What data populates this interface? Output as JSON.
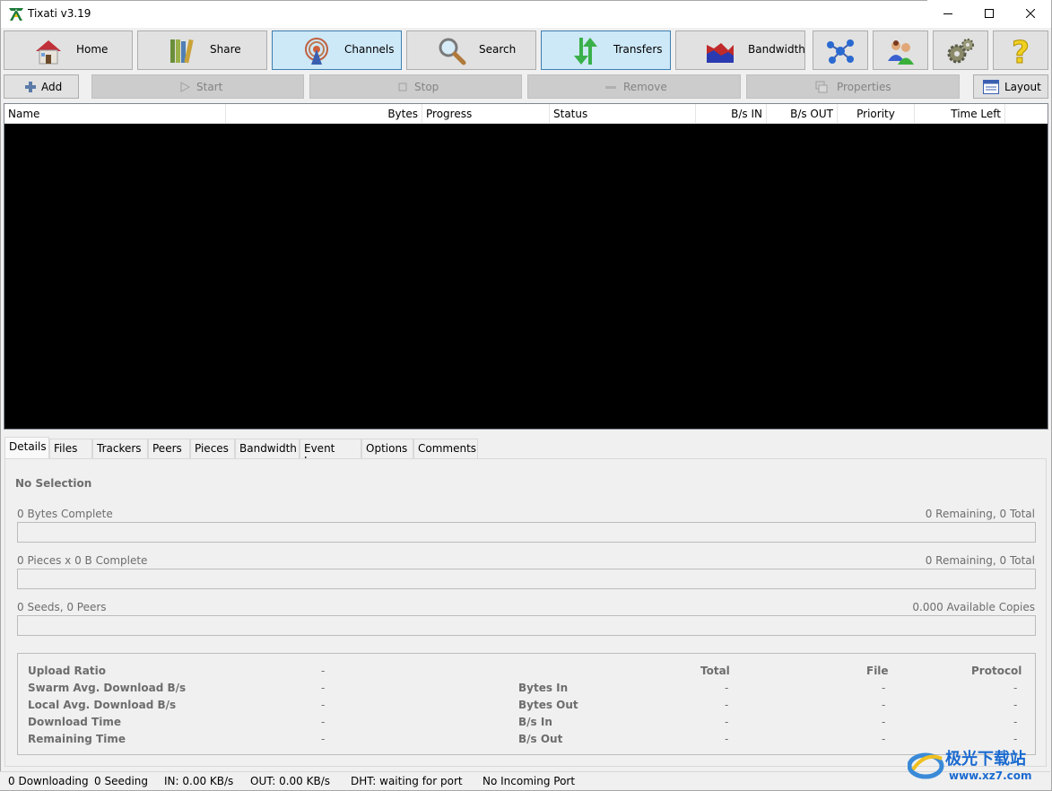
{
  "window": {
    "title": "Tixati v3.19"
  },
  "toolbar": {
    "home": "Home",
    "share": "Share",
    "channels": "Channels",
    "search": "Search",
    "transfers": "Transfers",
    "bandwidth": "Bandwidth",
    "active": "Transfers"
  },
  "actions": {
    "add": "Add",
    "start": "Start",
    "stop": "Stop",
    "remove": "Remove",
    "properties": "Properties",
    "layout": "Layout"
  },
  "columns": [
    "Name",
    "Bytes",
    "Progress",
    "Status",
    "B/s IN",
    "B/s OUT",
    "Priority",
    "Time Left"
  ],
  "tabs": [
    "Details",
    "Files",
    "Trackers",
    "Peers",
    "Pieces",
    "Bandwidth",
    "Event Log",
    "Options",
    "Comments"
  ],
  "details": {
    "selection": "No Selection",
    "bytes_complete": "0 Bytes Complete",
    "bytes_remaining": "0 Remaining,  0 Total",
    "pieces_complete": "0 Pieces  x  0 B Complete",
    "pieces_remaining": "0 Remaining,  0 Total",
    "seeds_peers": "0 Seeds, 0 Peers",
    "available_copies": "0.000 Available Copies",
    "bytes_progress": 0,
    "pieces_progress": 0,
    "availability_progress": 0
  },
  "stats": {
    "left": [
      {
        "label": "Upload Ratio",
        "value": "-"
      },
      {
        "label": "Swarm Avg. Download B/s",
        "value": "-"
      },
      {
        "label": "Local Avg. Download B/s",
        "value": "-"
      },
      {
        "label": "Download Time",
        "value": "-"
      },
      {
        "label": "Remaining Time",
        "value": "-"
      }
    ],
    "headers": {
      "total": "Total",
      "file": "File",
      "protocol": "Protocol"
    },
    "right": [
      {
        "label": "Bytes In",
        "total": "-",
        "file": "-",
        "protocol": "-"
      },
      {
        "label": "Bytes Out",
        "total": "-",
        "file": "-",
        "protocol": "-"
      },
      {
        "label": "B/s In",
        "total": "-",
        "file": "-",
        "protocol": "-"
      },
      {
        "label": "B/s Out",
        "total": "-",
        "file": "-",
        "protocol": "-"
      }
    ]
  },
  "status": {
    "downloading": "0 Downloading",
    "seeding": "0 Seeding",
    "in": "IN: 0.00 KB/s",
    "out": "OUT: 0.00 KB/s",
    "dht": "DHT: waiting for port",
    "port": "No Incoming Port"
  },
  "watermark": {
    "brand": "极光下载站",
    "url": "www.xz7.com"
  },
  "colors": {
    "active_button": "#cde8f7",
    "list_background": "#000000",
    "disabled_button": "#cccccc"
  }
}
